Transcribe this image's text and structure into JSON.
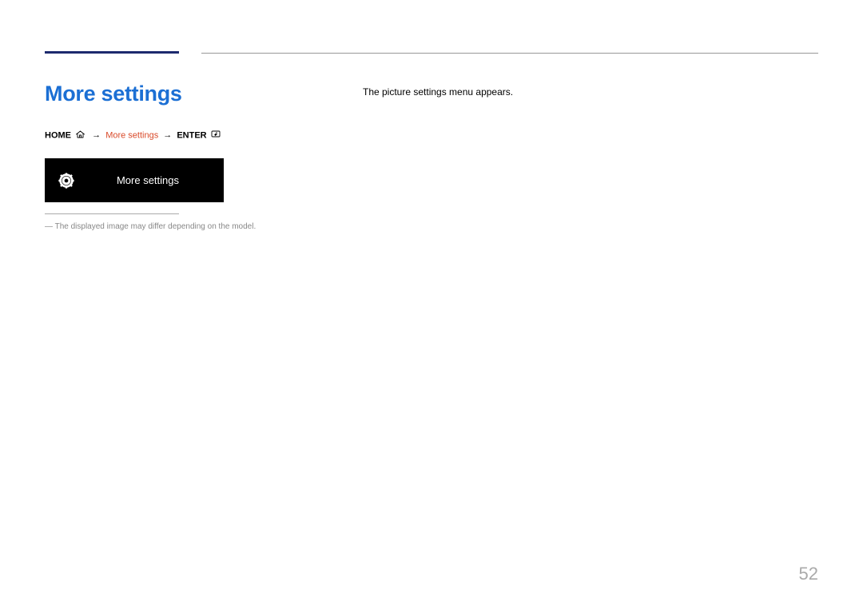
{
  "title": "More settings",
  "breadcrumb": {
    "home": "HOME",
    "step": "More settings",
    "enter": "ENTER"
  },
  "menu_item": {
    "label": "More settings"
  },
  "note": "― The displayed image may differ depending on the model.",
  "body_text": "The picture settings menu appears.",
  "page_number": "52"
}
